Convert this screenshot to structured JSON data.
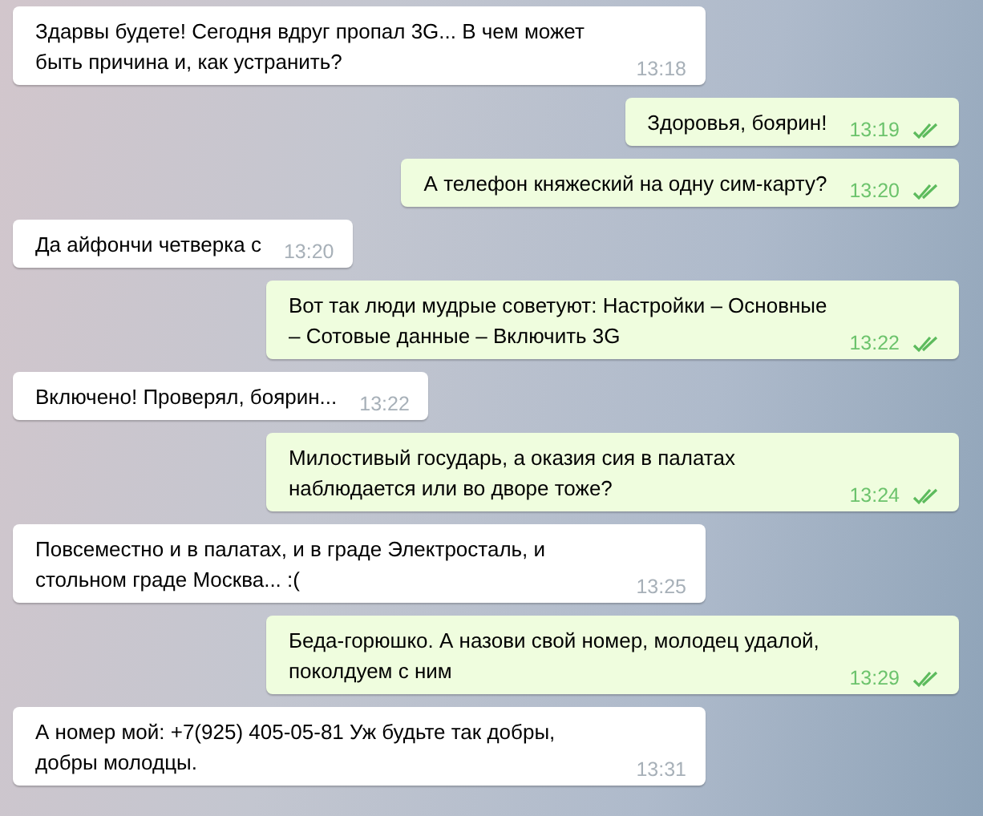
{
  "messages": [
    {
      "kind": "incoming",
      "text": "Здарвы будете! Сегодня вдруг пропал 3G... В чем может быть причина и, как устранить?",
      "time": "13:18"
    },
    {
      "kind": "outgoing",
      "text": "Здоровья, боярин!",
      "time": "13:19",
      "read": true
    },
    {
      "kind": "outgoing",
      "text": "А телефон княжеский на одну сим-карту?",
      "time": "13:20",
      "read": true
    },
    {
      "kind": "incoming",
      "text": "Да айфончи четверка с",
      "time": "13:20"
    },
    {
      "kind": "outgoing",
      "text": "Вот так люди мудрые советуют: Настройки – Основные – Сотовые данные – Включить 3G",
      "time": "13:22",
      "read": true
    },
    {
      "kind": "incoming",
      "text": "Включено! Проверял, боярин...",
      "time": "13:22"
    },
    {
      "kind": "outgoing",
      "text": "Милостивый государь, а оказия сия в палатах наблюдается или во дворе тоже?",
      "time": "13:24",
      "read": true
    },
    {
      "kind": "incoming",
      "text": "Повсеместно и в палатах, и в граде Электросталь, и стольном граде Москва... :(",
      "time": "13:25"
    },
    {
      "kind": "outgoing",
      "text": "Беда-горюшко. А назови свой номер, молодец удалой, поколдуем с ним",
      "time": "13:29",
      "read": true
    },
    {
      "kind": "incoming",
      "text": "А номер мой: +7(925) 405-05-81 Уж будьте так добры, добры молодцы.",
      "time": "13:31"
    }
  ]
}
